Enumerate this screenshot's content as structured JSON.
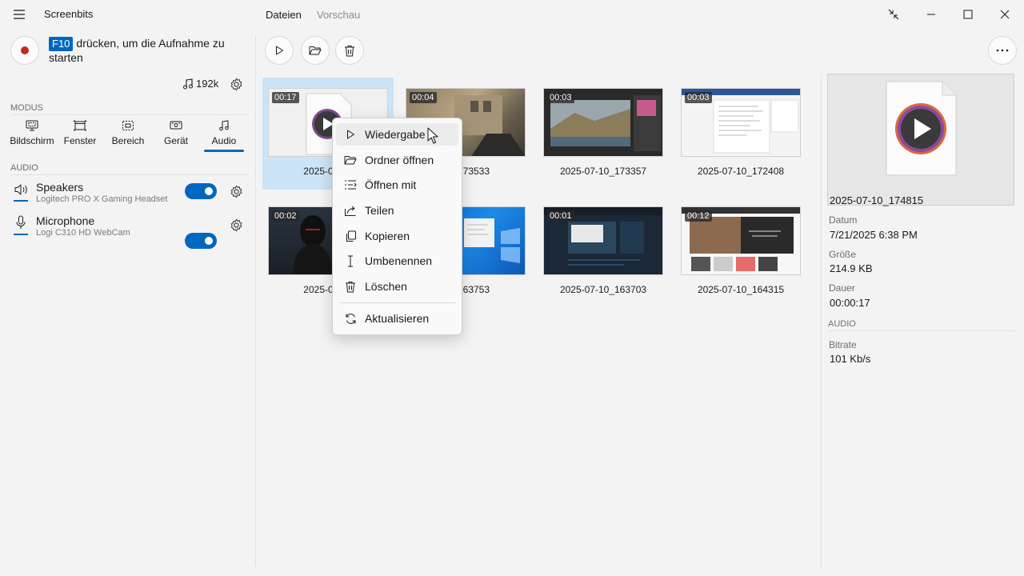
{
  "app": {
    "title": "Screenbits",
    "tabs": [
      {
        "label": "Dateien",
        "active": true
      },
      {
        "label": "Vorschau",
        "active": false
      }
    ],
    "accent": "#0067c0",
    "record_color": "#c42b1c"
  },
  "left": {
    "hint_key": "F10",
    "hint_text": "drücken, um die Aufnahme zu starten",
    "bitrate": "192k",
    "mode_section": "MODUS",
    "modes": [
      {
        "label": "Bildschirm",
        "icon": "screen-icon"
      },
      {
        "label": "Fenster",
        "icon": "window-icon"
      },
      {
        "label": "Bereich",
        "icon": "region-icon"
      },
      {
        "label": "Gerät",
        "icon": "device-icon"
      },
      {
        "label": "Audio",
        "icon": "music-icon",
        "active": true
      }
    ],
    "audio_section": "AUDIO",
    "devices": [
      {
        "name": "Speakers",
        "sub": "Logitech PRO X Gaming Headset",
        "on": true,
        "icon": "speaker-icon"
      },
      {
        "name": "Microphone",
        "sub": "Logi C310 HD WebCam",
        "on": true,
        "icon": "microphone-icon"
      }
    ]
  },
  "files": [
    {
      "name": "2025-07-10_174815",
      "visible_name": "2025-07-10",
      "duration": "00:17",
      "selected": true
    },
    {
      "name": "2025-07-10_173533",
      "visible_name": "10_173533",
      "duration": "00:04"
    },
    {
      "name": "2025-07-10_173357",
      "visible_name": "2025-07-10_173357",
      "duration": "00:03"
    },
    {
      "name": "2025-07-10_172408",
      "visible_name": "2025-07-10_172408",
      "duration": "00:03"
    },
    {
      "name": "2025-07-10_...",
      "visible_name": "2025-07-10",
      "duration": "00:02"
    },
    {
      "name": "2025-07-10_163753",
      "visible_name": "10_163753",
      "duration": ""
    },
    {
      "name": "2025-07-10_163703",
      "visible_name": "2025-07-10_163703",
      "duration": "00:01"
    },
    {
      "name": "2025-07-10_164315",
      "visible_name": "2025-07-10_164315",
      "duration": "00:12"
    }
  ],
  "context_menu": [
    {
      "label": "Wiedergabe",
      "icon": "play-icon"
    },
    {
      "label": "Ordner öffnen",
      "icon": "folder-open-icon"
    },
    {
      "label": "Öffnen mit",
      "icon": "open-with-icon"
    },
    {
      "label": "Teilen",
      "icon": "share-icon"
    },
    {
      "label": "Kopieren",
      "icon": "copy-icon"
    },
    {
      "label": "Umbenennen",
      "icon": "rename-icon"
    },
    {
      "label": "Löschen",
      "icon": "delete-icon"
    },
    {
      "label": "Aktualisieren",
      "icon": "refresh-icon"
    }
  ],
  "details": {
    "filename": "2025-07-10_174815",
    "date_label": "Datum",
    "date": "7/21/2025 6:38 PM",
    "size_label": "Größe",
    "size": "214.9 KB",
    "duration_label": "Dauer",
    "duration": "00:00:17",
    "audio_section": "AUDIO",
    "bitrate_label": "Bitrate",
    "bitrate": "101 Kb/s"
  }
}
